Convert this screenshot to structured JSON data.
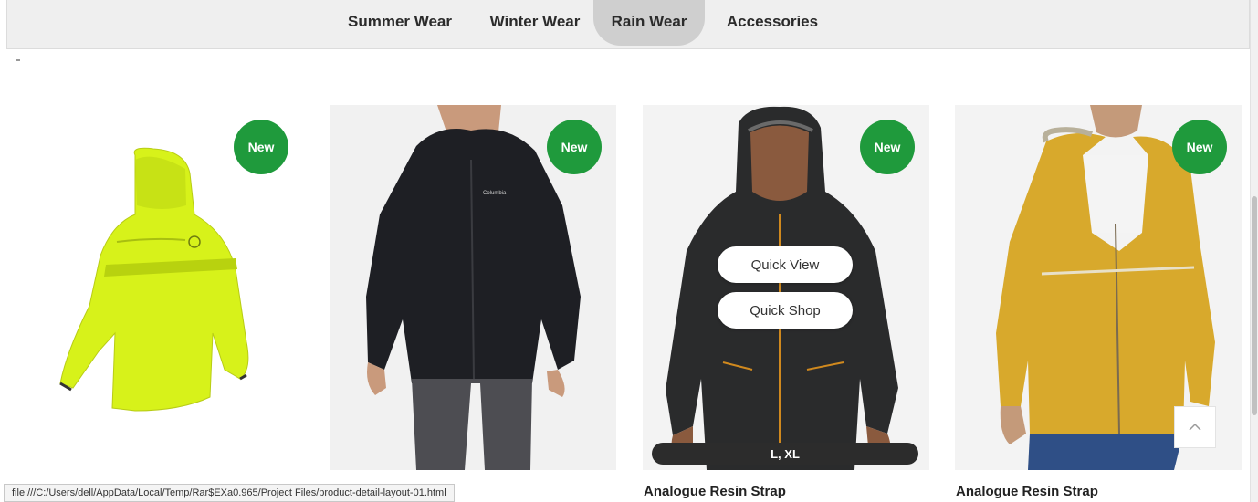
{
  "tabs": [
    {
      "label": "Summer Wear",
      "active": false
    },
    {
      "label": "Winter Wear",
      "active": false
    },
    {
      "label": "Rain Wear",
      "active": true
    },
    {
      "label": "Accessories",
      "active": false
    }
  ],
  "products": [
    {
      "badge": "New",
      "image": "neon-yellow-rain-jacket-back"
    },
    {
      "badge": "New",
      "image": "black-columbia-rain-jacket"
    },
    {
      "badge": "New",
      "image": "black-hooded-raincoat",
      "quick_view": "Quick View",
      "quick_shop": "Quick Shop",
      "sizes": "L, XL",
      "title": "Analogue Resin Strap"
    },
    {
      "badge": "New",
      "image": "mustard-yellow-rain-jacket",
      "title": "Analogue Resin Strap"
    }
  ],
  "status_url": "file:///C:/Users/dell/AppData/Local/Temp/Rar$EXa0.965/Project Files/product-detail-layout-01.html",
  "icons": {
    "back_to_top": "chevron-up-icon"
  },
  "colors": {
    "badge": "#1f9a3c",
    "tab_active": "#cfcfcf",
    "tabbar": "#efefef"
  }
}
